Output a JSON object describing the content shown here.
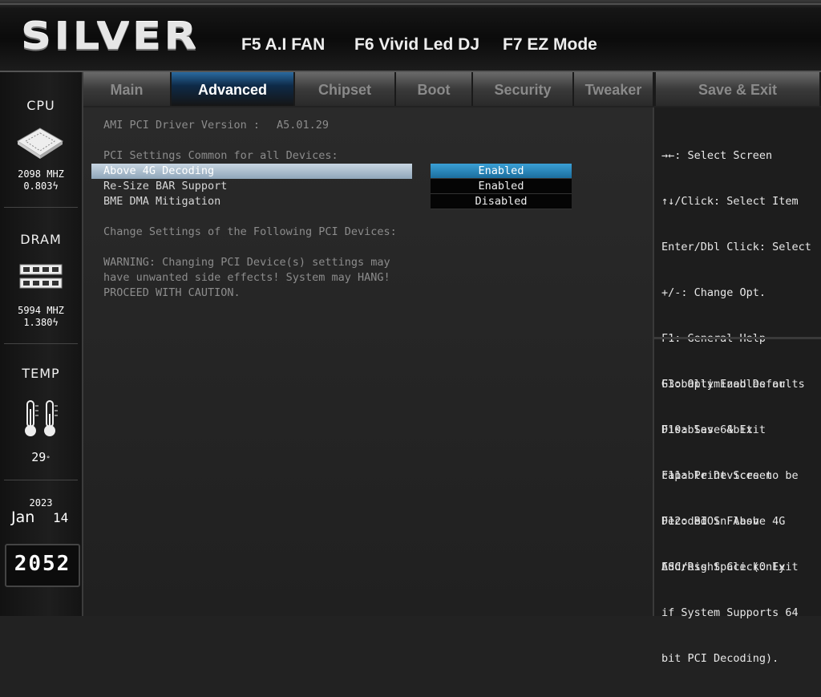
{
  "header": {
    "logo": "SILVER",
    "hotkeys": [
      "F5 A.I FAN",
      "F6 Vivid Led DJ",
      "F7 EZ Mode"
    ]
  },
  "tabs": [
    "Main",
    "Advanced",
    "Chipset",
    "Boot",
    "Security",
    "Tweaker",
    "Save & Exit"
  ],
  "active_tab": "Advanced",
  "sidebar": {
    "cpu": {
      "label": "CPU",
      "freq": "2098 MHZ",
      "volt": "0.803",
      "icon": "cpu-chip-icon"
    },
    "dram": {
      "label": "DRAM",
      "freq": "5994 MHZ",
      "volt": "1.380",
      "icon": "memory-module-icon"
    },
    "temp": {
      "label": "TEMP",
      "value": "29",
      "icon": "thermometer-icon"
    },
    "date": {
      "year": "2023",
      "month": "Jan",
      "day": "14"
    },
    "time": "2052"
  },
  "main": {
    "driver_label": "AMI PCI Driver Version :",
    "driver_version": "A5.01.29",
    "section_common": "PCI Settings Common for all Devices:",
    "settings": [
      {
        "label": "Above 4G Decoding",
        "value": "Enabled",
        "selected": true
      },
      {
        "label": "Re-Size BAR Support",
        "value": "Enabled",
        "selected": false
      },
      {
        "label": "BME DMA Mitigation",
        "value": "Disabled",
        "selected": false
      }
    ],
    "section_change": "Change Settings of the Following PCI Devices:",
    "warning": [
      "WARNING: Changing PCI Device(s) settings may",
      "have unwanted side effects! System may HANG!",
      "PROCEED WITH CAUTION."
    ]
  },
  "help": {
    "keys": [
      "→←: Select Screen",
      "↑↓/Click: Select Item",
      "Enter/Dbl Click: Select",
      "+/-: Change Opt.",
      "F1: General Help",
      "F3: Optimized Defaults",
      "F10: Save & Exit",
      "F11: Print Screen",
      "F12: BIOS Flash",
      "ESC/Right Click: Exit"
    ],
    "description": [
      "Globally Enables or",
      "Disables 64bit",
      "capable Devices to be",
      "Decoded in Above 4G",
      "Address Space (Only",
      "if System Supports 64",
      "bit PCI Decoding)."
    ]
  },
  "colors": {
    "accent": "#2a8cc4",
    "selection": "#9fb4c6"
  }
}
